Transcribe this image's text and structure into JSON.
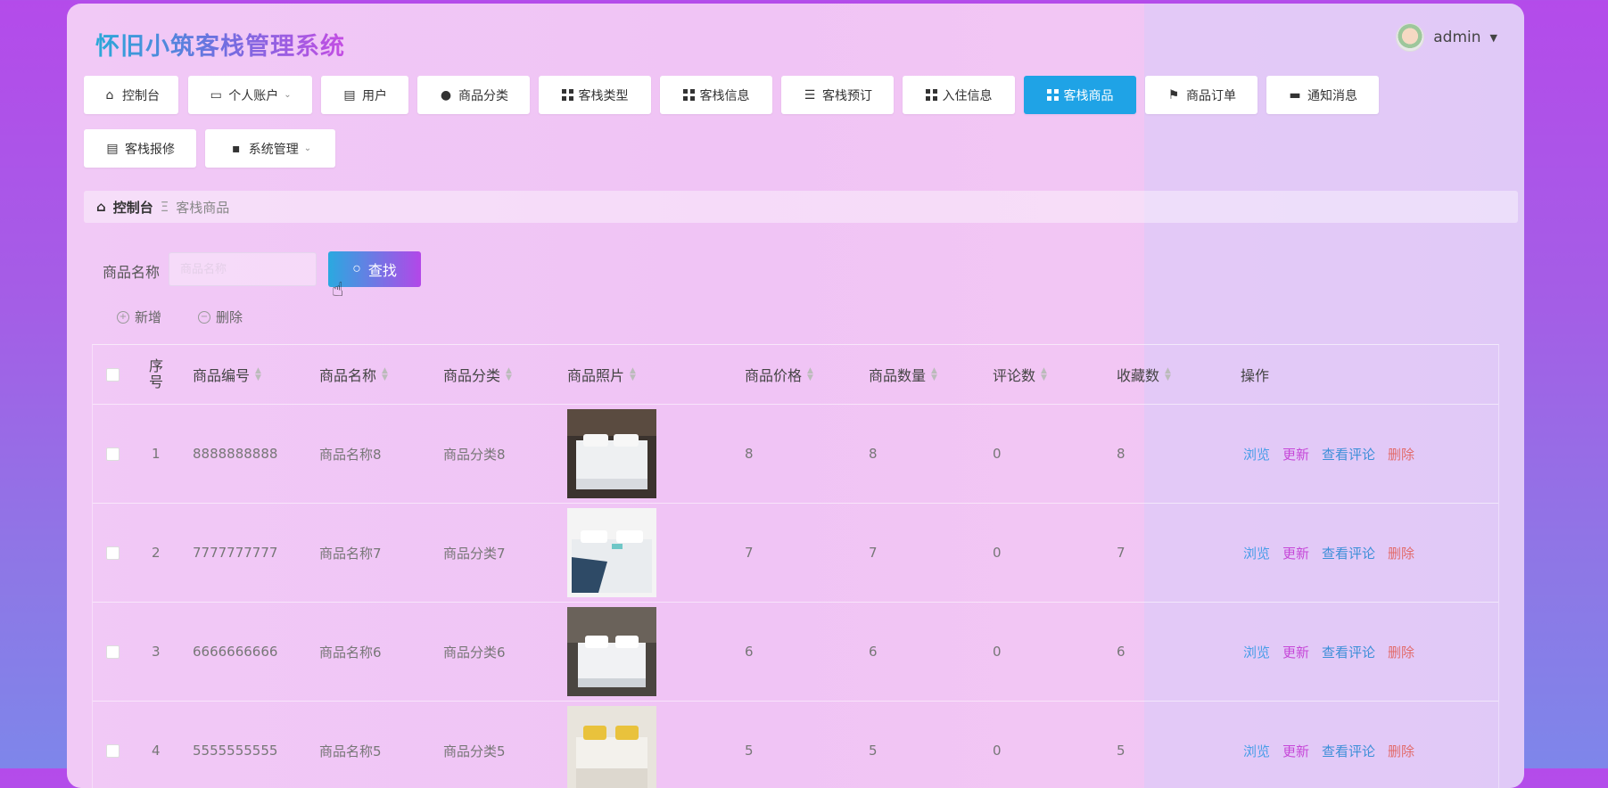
{
  "app_title": "怀旧小筑客栈管理系统",
  "user": {
    "name": "admin"
  },
  "nav": [
    {
      "label": "控制台",
      "icon": "home-icon"
    },
    {
      "label": "个人账户",
      "icon": "wallet-icon",
      "dropdown": true
    },
    {
      "label": "用户",
      "icon": "clipboard-icon"
    },
    {
      "label": "商品分类",
      "icon": "pin-icon"
    },
    {
      "label": "客栈类型",
      "icon": "grid-icon"
    },
    {
      "label": "客栈信息",
      "icon": "grid-icon"
    },
    {
      "label": "客栈预订",
      "icon": "list-icon"
    },
    {
      "label": "入住信息",
      "icon": "grid-icon"
    },
    {
      "label": "客栈商品",
      "icon": "grid-icon",
      "active": true
    },
    {
      "label": "商品订单",
      "icon": "flag-icon"
    },
    {
      "label": "通知消息",
      "icon": "monitor-icon"
    },
    {
      "label": "客栈报修",
      "icon": "clipboard-icon"
    },
    {
      "label": "系统管理",
      "icon": "chat-icon",
      "dropdown": true
    }
  ],
  "breadcrumb": {
    "home": "控制台",
    "current": "客栈商品"
  },
  "search": {
    "label": "商品名称",
    "placeholder": "商品名称",
    "button": "查找"
  },
  "actions": {
    "add": "新增",
    "delete": "删除"
  },
  "table": {
    "headers": [
      "序号",
      "商品编号",
      "商品名称",
      "商品分类",
      "商品照片",
      "商品价格",
      "商品数量",
      "评论数",
      "收藏数",
      "操作"
    ],
    "rows": [
      {
        "index": "1",
        "code": "8888888888",
        "name": "商品名称8",
        "category": "商品分类8",
        "price": "8",
        "quantity": "8",
        "comments": "0",
        "favorites": "8"
      },
      {
        "index": "2",
        "code": "7777777777",
        "name": "商品名称7",
        "category": "商品分类7",
        "price": "7",
        "quantity": "7",
        "comments": "0",
        "favorites": "7"
      },
      {
        "index": "3",
        "code": "6666666666",
        "name": "商品名称6",
        "category": "商品分类6",
        "price": "6",
        "quantity": "6",
        "comments": "0",
        "favorites": "6"
      },
      {
        "index": "4",
        "code": "5555555555",
        "name": "商品名称5",
        "category": "商品分类5",
        "price": "5",
        "quantity": "5",
        "comments": "0",
        "favorites": "5"
      }
    ],
    "row_actions": {
      "view": "浏览",
      "update": "更新",
      "comments": "查看评论",
      "delete": "删除"
    }
  },
  "colors": {
    "active_tab": "#1fa3e6",
    "view_link": "#4a9ee8",
    "update_link": "#c648d8",
    "delete_link": "#e26b6b"
  }
}
